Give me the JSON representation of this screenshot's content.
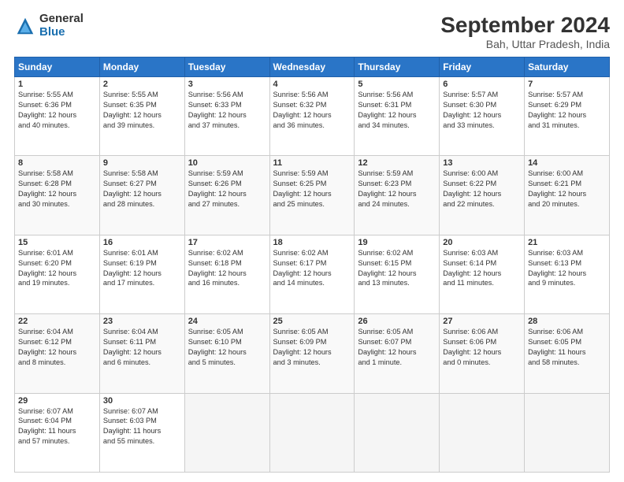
{
  "logo": {
    "general": "General",
    "blue": "Blue"
  },
  "title": "September 2024",
  "subtitle": "Bah, Uttar Pradesh, India",
  "headers": [
    "Sunday",
    "Monday",
    "Tuesday",
    "Wednesday",
    "Thursday",
    "Friday",
    "Saturday"
  ],
  "weeks": [
    [
      {
        "day": "1",
        "rise": "5:55 AM",
        "set": "6:36 PM",
        "hours": "12 hours",
        "mins": "40 minutes."
      },
      {
        "day": "2",
        "rise": "5:55 AM",
        "set": "6:35 PM",
        "hours": "12 hours",
        "mins": "39 minutes."
      },
      {
        "day": "3",
        "rise": "5:56 AM",
        "set": "6:33 PM",
        "hours": "12 hours",
        "mins": "37 minutes."
      },
      {
        "day": "4",
        "rise": "5:56 AM",
        "set": "6:32 PM",
        "hours": "12 hours",
        "mins": "36 minutes."
      },
      {
        "day": "5",
        "rise": "5:56 AM",
        "set": "6:31 PM",
        "hours": "12 hours",
        "mins": "34 minutes."
      },
      {
        "day": "6",
        "rise": "5:57 AM",
        "set": "6:30 PM",
        "hours": "12 hours",
        "mins": "33 minutes."
      },
      {
        "day": "7",
        "rise": "5:57 AM",
        "set": "6:29 PM",
        "hours": "12 hours",
        "mins": "31 minutes."
      }
    ],
    [
      {
        "day": "8",
        "rise": "5:58 AM",
        "set": "6:28 PM",
        "hours": "12 hours",
        "mins": "30 minutes."
      },
      {
        "day": "9",
        "rise": "5:58 AM",
        "set": "6:27 PM",
        "hours": "12 hours",
        "mins": "28 minutes."
      },
      {
        "day": "10",
        "rise": "5:59 AM",
        "set": "6:26 PM",
        "hours": "12 hours",
        "mins": "27 minutes."
      },
      {
        "day": "11",
        "rise": "5:59 AM",
        "set": "6:25 PM",
        "hours": "12 hours",
        "mins": "25 minutes."
      },
      {
        "day": "12",
        "rise": "5:59 AM",
        "set": "6:23 PM",
        "hours": "12 hours",
        "mins": "24 minutes."
      },
      {
        "day": "13",
        "rise": "6:00 AM",
        "set": "6:22 PM",
        "hours": "12 hours",
        "mins": "22 minutes."
      },
      {
        "day": "14",
        "rise": "6:00 AM",
        "set": "6:21 PM",
        "hours": "12 hours",
        "mins": "20 minutes."
      }
    ],
    [
      {
        "day": "15",
        "rise": "6:01 AM",
        "set": "6:20 PM",
        "hours": "12 hours",
        "mins": "19 minutes."
      },
      {
        "day": "16",
        "rise": "6:01 AM",
        "set": "6:19 PM",
        "hours": "12 hours",
        "mins": "17 minutes."
      },
      {
        "day": "17",
        "rise": "6:02 AM",
        "set": "6:18 PM",
        "hours": "12 hours",
        "mins": "16 minutes."
      },
      {
        "day": "18",
        "rise": "6:02 AM",
        "set": "6:17 PM",
        "hours": "12 hours",
        "mins": "14 minutes."
      },
      {
        "day": "19",
        "rise": "6:02 AM",
        "set": "6:15 PM",
        "hours": "12 hours",
        "mins": "13 minutes."
      },
      {
        "day": "20",
        "rise": "6:03 AM",
        "set": "6:14 PM",
        "hours": "12 hours",
        "mins": "11 minutes."
      },
      {
        "day": "21",
        "rise": "6:03 AM",
        "set": "6:13 PM",
        "hours": "12 hours",
        "mins": "9 minutes."
      }
    ],
    [
      {
        "day": "22",
        "rise": "6:04 AM",
        "set": "6:12 PM",
        "hours": "12 hours",
        "mins": "8 minutes."
      },
      {
        "day": "23",
        "rise": "6:04 AM",
        "set": "6:11 PM",
        "hours": "12 hours",
        "mins": "6 minutes."
      },
      {
        "day": "24",
        "rise": "6:05 AM",
        "set": "6:10 PM",
        "hours": "12 hours",
        "mins": "5 minutes."
      },
      {
        "day": "25",
        "rise": "6:05 AM",
        "set": "6:09 PM",
        "hours": "12 hours",
        "mins": "3 minutes."
      },
      {
        "day": "26",
        "rise": "6:05 AM",
        "set": "6:07 PM",
        "hours": "12 hours",
        "mins": "1 minute."
      },
      {
        "day": "27",
        "rise": "6:06 AM",
        "set": "6:06 PM",
        "hours": "12 hours",
        "mins": "0 minutes."
      },
      {
        "day": "28",
        "rise": "6:06 AM",
        "set": "6:05 PM",
        "hours": "11 hours",
        "mins": "58 minutes."
      }
    ],
    [
      {
        "day": "29",
        "rise": "6:07 AM",
        "set": "6:04 PM",
        "hours": "11 hours",
        "mins": "57 minutes."
      },
      {
        "day": "30",
        "rise": "6:07 AM",
        "set": "6:03 PM",
        "hours": "11 hours",
        "mins": "55 minutes."
      },
      null,
      null,
      null,
      null,
      null
    ]
  ],
  "labels": {
    "sunrise": "Sunrise:",
    "sunset": "Sunset:",
    "daylight": "Daylight:"
  }
}
